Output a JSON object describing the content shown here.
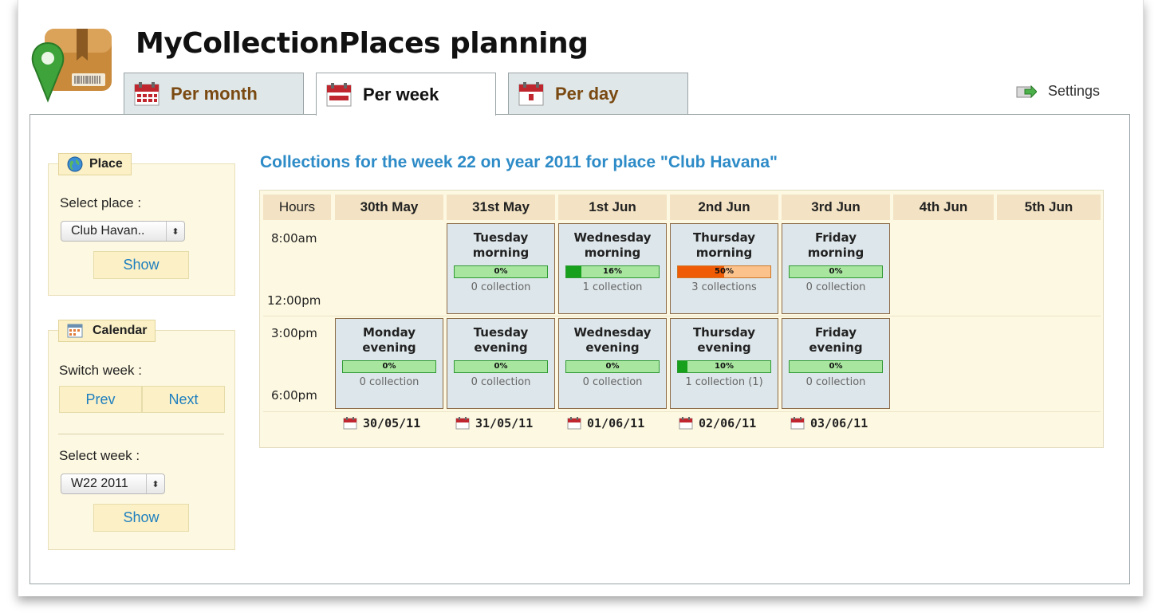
{
  "app": {
    "title": "MyCollectionPlaces planning"
  },
  "tabs": [
    {
      "label": "Per month"
    },
    {
      "label": "Per week"
    },
    {
      "label": "Per day"
    }
  ],
  "settings": {
    "label": "Settings"
  },
  "place_panel": {
    "legend": "Place",
    "select_label": "Select place :",
    "selected_place": "Club Havan..",
    "show_label": "Show"
  },
  "calendar_panel": {
    "legend": "Calendar",
    "switch_label": "Switch week :",
    "prev_label": "Prev",
    "next_label": "Next",
    "select_week_label": "Select week :",
    "selected_week": "W22 2011",
    "show_label": "Show"
  },
  "week_title": "Collections for the week 22 on year 2011 for place \"Club Havana\"",
  "table": {
    "hours_header": "Hours",
    "days": [
      "30th May",
      "31st May",
      "1st Jun",
      "2nd Jun",
      "3rd Jun",
      "4th Jun",
      "5th Jun"
    ],
    "times": {
      "morning_start": "8:00am",
      "morning_end": "12:00pm",
      "evening_start": "3:00pm",
      "evening_end": "6:00pm"
    },
    "morning": [
      {
        "title1": "Tuesday",
        "title2": "morning",
        "percent_label": "0%",
        "percent": 0,
        "count": "0 collection"
      },
      {
        "title1": "Wednesday",
        "title2": "morning",
        "percent_label": "16%",
        "percent": 16,
        "count": "1 collection"
      },
      {
        "title1": "Thursday",
        "title2": "morning",
        "percent_label": "50%",
        "percent": 50,
        "count": "3 collections"
      },
      {
        "title1": "Friday",
        "title2": "morning",
        "percent_label": "0%",
        "percent": 0,
        "count": "0 collection"
      }
    ],
    "evening": [
      {
        "title1": "Monday",
        "title2": "evening",
        "percent_label": "0%",
        "percent": 0,
        "count": "0 collection"
      },
      {
        "title1": "Tuesday",
        "title2": "evening",
        "percent_label": "0%",
        "percent": 0,
        "count": "0 collection"
      },
      {
        "title1": "Wednesday",
        "title2": "evening",
        "percent_label": "0%",
        "percent": 0,
        "count": "0 collection"
      },
      {
        "title1": "Thursday",
        "title2": "evening",
        "percent_label": "10%",
        "percent": 10,
        "count": "1 collection (1)"
      },
      {
        "title1": "Friday",
        "title2": "evening",
        "percent_label": "0%",
        "percent": 0,
        "count": "0 collection"
      }
    ],
    "dates": [
      "30/05/11",
      "31/05/11",
      "01/06/11",
      "02/06/11",
      "03/06/11"
    ]
  },
  "icons": {
    "logo": "map-pin-package-logo",
    "calendar": "calendar-icon",
    "settings": "settings-arrow-icon",
    "globe": "globe-icon"
  },
  "colors": {
    "title_blue": "#2d8bc7",
    "tab_brown": "#7a4a12",
    "bar_green": "#17a01c",
    "bar_orange": "#f05b06",
    "panel_bg": "#fdf8e1"
  }
}
